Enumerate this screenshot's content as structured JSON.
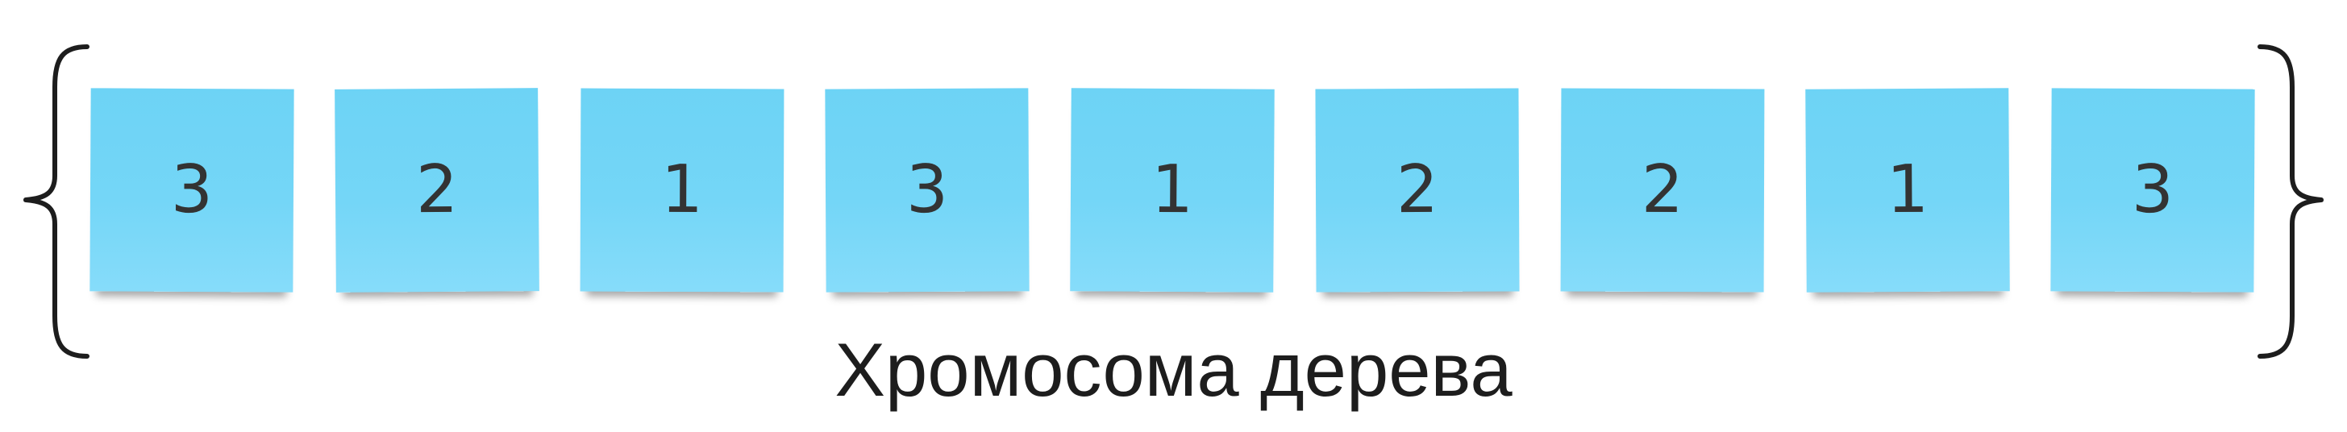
{
  "genes": [
    "3",
    "2",
    "1",
    "3",
    "1",
    "2",
    "2",
    "1",
    "3"
  ],
  "caption": "Хромосома дерева",
  "colors": {
    "note": "#74d6f7",
    "text": "#333333",
    "brace": "#1d1d1d"
  }
}
